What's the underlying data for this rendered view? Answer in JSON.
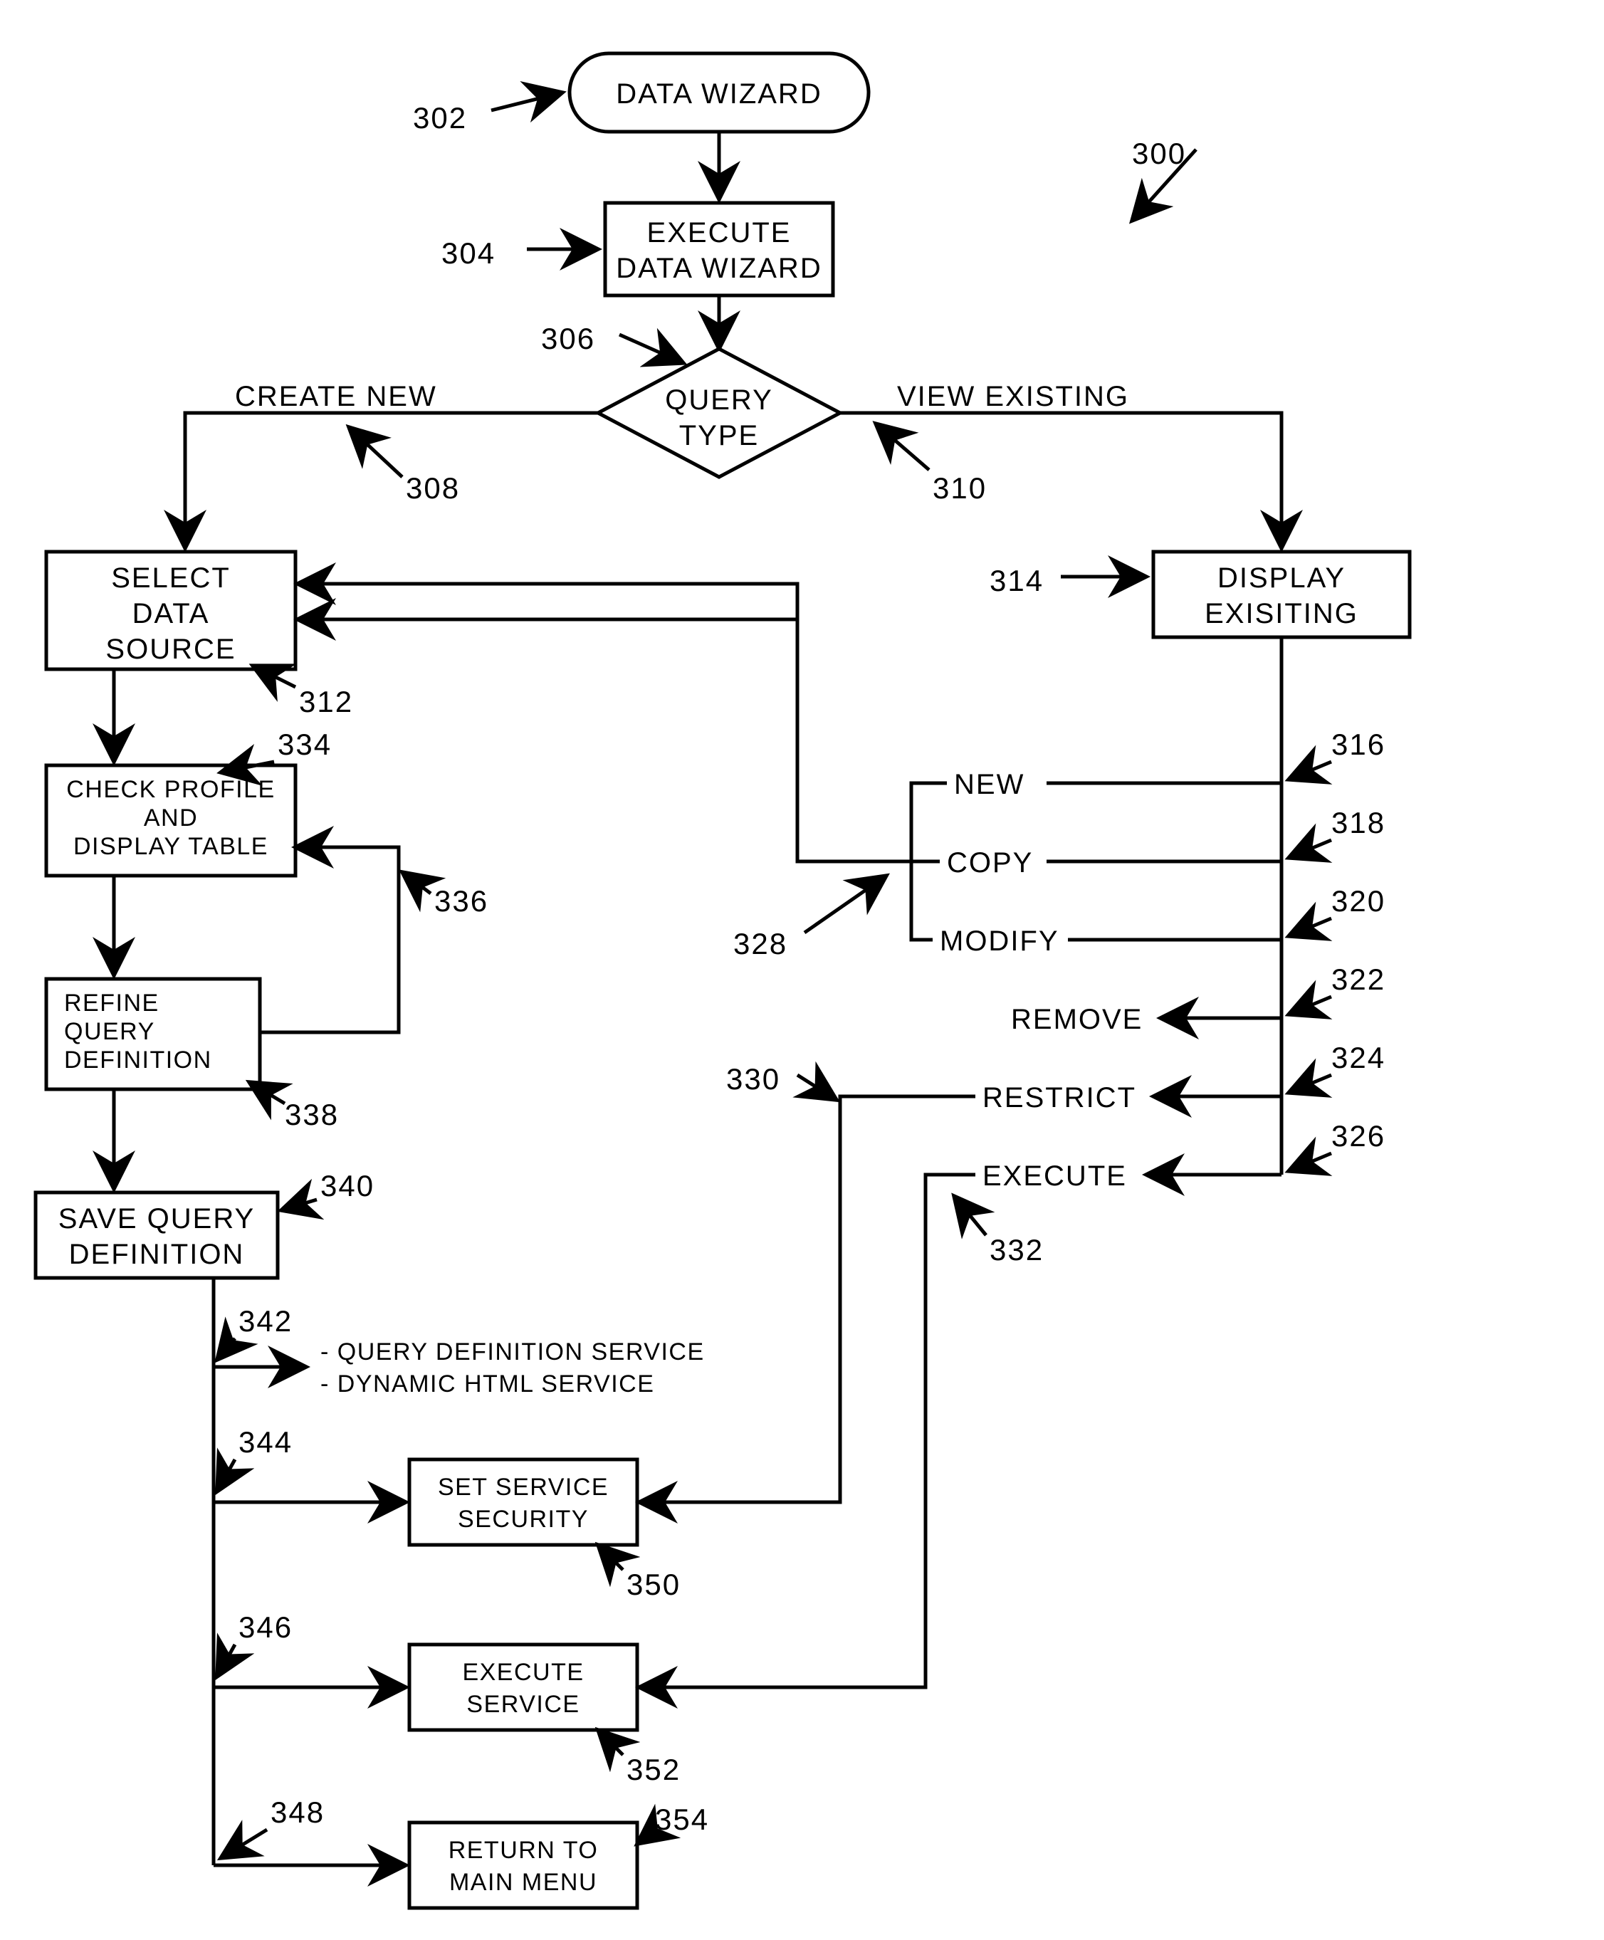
{
  "chart_data": {
    "type": "flowchart",
    "title": "",
    "nodes": [
      {
        "id": "300",
        "kind": "diagram-ref",
        "label": "300"
      },
      {
        "id": "302",
        "kind": "terminator",
        "label": "DATA WIZARD"
      },
      {
        "id": "304",
        "kind": "process",
        "label": "EXECUTE DATA WIZARD"
      },
      {
        "id": "306",
        "kind": "decision",
        "label": "QUERY TYPE"
      },
      {
        "id": "308",
        "kind": "branch-label",
        "label": "CREATE NEW"
      },
      {
        "id": "310",
        "kind": "branch-label",
        "label": "VIEW EXISTING"
      },
      {
        "id": "312",
        "kind": "process",
        "label": "SELECT DATA SOURCE"
      },
      {
        "id": "314",
        "kind": "process",
        "label": "DISPLAY EXISITING"
      },
      {
        "id": "316",
        "kind": "option",
        "label": "NEW"
      },
      {
        "id": "318",
        "kind": "option",
        "label": "COPY"
      },
      {
        "id": "320",
        "kind": "option",
        "label": "MODIFY"
      },
      {
        "id": "322",
        "kind": "option",
        "label": "REMOVE"
      },
      {
        "id": "324",
        "kind": "option",
        "label": "RESTRICT"
      },
      {
        "id": "326",
        "kind": "option",
        "label": "EXECUTE"
      },
      {
        "id": "328",
        "kind": "group-ref",
        "targets": [
          "316",
          "318",
          "320"
        ]
      },
      {
        "id": "330",
        "kind": "ref"
      },
      {
        "id": "332",
        "kind": "ref"
      },
      {
        "id": "334",
        "kind": "process",
        "label": "CHECK PROFILE AND DISPLAY TABLE"
      },
      {
        "id": "336",
        "kind": "loop-ref"
      },
      {
        "id": "338",
        "kind": "process",
        "label": "REFINE QUERY DEFINITION"
      },
      {
        "id": "340",
        "kind": "process",
        "label": "SAVE QUERY DEFINITION"
      },
      {
        "id": "342",
        "kind": "note",
        "label": "- QUERY DEFINITION SERVICE\n- DYNAMIC HTML SERVICE"
      },
      {
        "id": "344",
        "kind": "branch-ref"
      },
      {
        "id": "346",
        "kind": "branch-ref"
      },
      {
        "id": "348",
        "kind": "branch-ref"
      },
      {
        "id": "350",
        "kind": "process",
        "label": "SET SERVICE SECURITY"
      },
      {
        "id": "352",
        "kind": "process",
        "label": "EXECUTE SERVICE"
      },
      {
        "id": "354",
        "kind": "process",
        "label": "RETURN TO MAIN MENU"
      }
    ],
    "edges": [
      {
        "from": "302",
        "to": "304"
      },
      {
        "from": "304",
        "to": "306"
      },
      {
        "from": "306",
        "to": "312",
        "label": "CREATE NEW"
      },
      {
        "from": "306",
        "to": "314",
        "label": "VIEW EXISTING"
      },
      {
        "from": "312",
        "to": "334"
      },
      {
        "from": "334",
        "to": "338"
      },
      {
        "from": "338",
        "to": "334",
        "kind": "loop"
      },
      {
        "from": "338",
        "to": "340"
      },
      {
        "from": "340",
        "to": "342"
      },
      {
        "from": "340",
        "to": "350",
        "via": "344"
      },
      {
        "from": "340",
        "to": "352",
        "via": "346"
      },
      {
        "from": "340",
        "to": "354",
        "via": "348"
      },
      {
        "from": "314",
        "to": "316"
      },
      {
        "from": "314",
        "to": "318"
      },
      {
        "from": "314",
        "to": "320"
      },
      {
        "from": "314",
        "to": "322"
      },
      {
        "from": "314",
        "to": "324"
      },
      {
        "from": "314",
        "to": "326"
      },
      {
        "from": "328",
        "to": "312",
        "targets": [
          "316",
          "318",
          "320"
        ]
      },
      {
        "from": "324",
        "to": "350",
        "via": "330"
      },
      {
        "from": "326",
        "to": "352",
        "via": "332"
      }
    ]
  },
  "nodes": {
    "n300": "300",
    "n302": "DATA WIZARD",
    "n304_l1": "EXECUTE",
    "n304_l2": "DATA WIZARD",
    "n306_l1": "QUERY",
    "n306_l2": "TYPE",
    "n308": "CREATE NEW",
    "n310": "VIEW EXISTING",
    "n312_l1": "SELECT",
    "n312_l2": "DATA",
    "n312_l3": "SOURCE",
    "n314_l1": "DISPLAY",
    "n314_l2": "EXISITING",
    "n316": "NEW",
    "n318": "COPY",
    "n320": "MODIFY",
    "n322": "REMOVE",
    "n324": "RESTRICT",
    "n326": "EXECUTE",
    "n334_l1": "CHECK PROFILE",
    "n334_l2": "AND",
    "n334_l3": "DISPLAY TABLE",
    "n338_l1": "REFINE",
    "n338_l2": "QUERY",
    "n338_l3": "DEFINITION",
    "n340_l1": "SAVE QUERY",
    "n340_l2": "DEFINITION",
    "n342_l1": "- QUERY DEFINITION SERVICE",
    "n342_l2": "- DYNAMIC HTML SERVICE",
    "n350_l1": "SET SERVICE",
    "n350_l2": "SECURITY",
    "n352_l1": "EXECUTE",
    "n352_l2": "SERVICE",
    "n354_l1": "RETURN TO",
    "n354_l2": "MAIN MENU"
  },
  "refs": {
    "r300": "300",
    "r302": "302",
    "r304": "304",
    "r306": "306",
    "r308": "308",
    "r310": "310",
    "r312": "312",
    "r314": "314",
    "r316": "316",
    "r318": "318",
    "r320": "320",
    "r322": "322",
    "r324": "324",
    "r326": "326",
    "r328": "328",
    "r330": "330",
    "r332": "332",
    "r334": "334",
    "r336": "336",
    "r338": "338",
    "r340": "340",
    "r342": "342",
    "r344": "344",
    "r346": "346",
    "r348": "348",
    "r350": "350",
    "r352": "352",
    "r354": "354"
  }
}
